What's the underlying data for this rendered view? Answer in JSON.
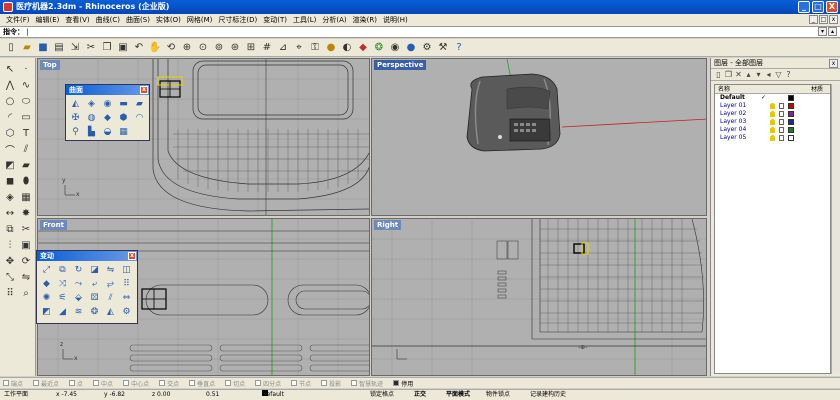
{
  "window": {
    "title": "医疗机器2.3dm - Rhinoceros (企业版)",
    "buttons": [
      "_",
      "□",
      "X"
    ]
  },
  "menu": {
    "items": [
      "文件(F)",
      "编辑(E)",
      "查看(V)",
      "曲线(C)",
      "曲面(S)",
      "实体(O)",
      "网格(M)",
      "尺寸标注(D)",
      "变动(T)",
      "工具(L)",
      "分析(A)",
      "渲染(R)",
      "说明(H)"
    ]
  },
  "command": {
    "label": "指令：",
    "value": "|"
  },
  "toolbar": {
    "icons": [
      "new-file-icon",
      "open-folder-icon",
      "save-icon",
      "print-icon",
      "import-icon",
      "cut-icon",
      "copy-icon",
      "paste-icon",
      "undo-icon",
      "pan-hand-icon",
      "rotate-view-icon",
      "zoom-icon",
      "zoom-window-icon",
      "zoom-extents-icon",
      "zoom-selected-icon",
      "four-view-icon",
      "grid-icon",
      "cplane-icon",
      "snap-icon",
      "lock-icon",
      "lightbulb-icon",
      "shade-icon",
      "layer-icon",
      "color-wheel-icon",
      "sphere-icon",
      "render-icon",
      "settings-icon",
      "tools-icon",
      "help-icon"
    ]
  },
  "viewports": {
    "top": {
      "label": "Top"
    },
    "perspective": {
      "label": "Perspective"
    },
    "front": {
      "label": "Front"
    },
    "right": {
      "label": "Right"
    }
  },
  "axis_labels": {
    "x": "x",
    "y": "y",
    "z": "z"
  },
  "panels": {
    "surface": {
      "title": "曲面"
    },
    "transform": {
      "title": "变动"
    }
  },
  "layers_panel": {
    "title": "图层 - 全部图层",
    "columns": {
      "name": "名称",
      "material": "材质"
    },
    "rows": [
      {
        "name": "Default",
        "current": true,
        "check": "✓",
        "color": "#000000"
      },
      {
        "name": "Layer 01",
        "current": false,
        "check": "",
        "color": "#cc0000"
      },
      {
        "name": "Layer 02",
        "current": false,
        "check": "",
        "color": "#7a2a8a"
      },
      {
        "name": "Layer 03",
        "current": false,
        "check": "",
        "color": "#1a2aa0"
      },
      {
        "name": "Layer 04",
        "current": false,
        "check": "",
        "color": "#1a7a2a"
      },
      {
        "name": "Layer 05",
        "current": false,
        "check": "",
        "color": "#ffffff"
      }
    ]
  },
  "snaps": [
    {
      "label": "端点",
      "on": false
    },
    {
      "label": "最近点",
      "on": false
    },
    {
      "label": "点",
      "on": false
    },
    {
      "label": "中点",
      "on": false
    },
    {
      "label": "中心点",
      "on": false
    },
    {
      "label": "交点",
      "on": false
    },
    {
      "label": "垂直点",
      "on": false
    },
    {
      "label": "切点",
      "on": false
    },
    {
      "label": "四分点",
      "on": false
    },
    {
      "label": "节点",
      "on": false
    },
    {
      "label": "投影",
      "on": false
    },
    {
      "label": "智慧轨迹",
      "on": false
    },
    {
      "label": "停用",
      "on": true
    }
  ],
  "status": {
    "cplane": "工作平面",
    "x": "x -7.45",
    "y": "y -6.82",
    "z": "z 0.00",
    "value": "0.51",
    "layer": "Default",
    "grid_snap": "锁定格点",
    "ortho": "正交",
    "planar": "平面模式",
    "osnap": "物件锁点",
    "history": "记录建构历史"
  },
  "colors": {
    "titlebar": "#0a5fd6",
    "viewport_bg": "#b0b0b0",
    "grid_green": "#2aa02a",
    "axis_red": "#c02020",
    "selection_yellow": "#e6d400"
  }
}
